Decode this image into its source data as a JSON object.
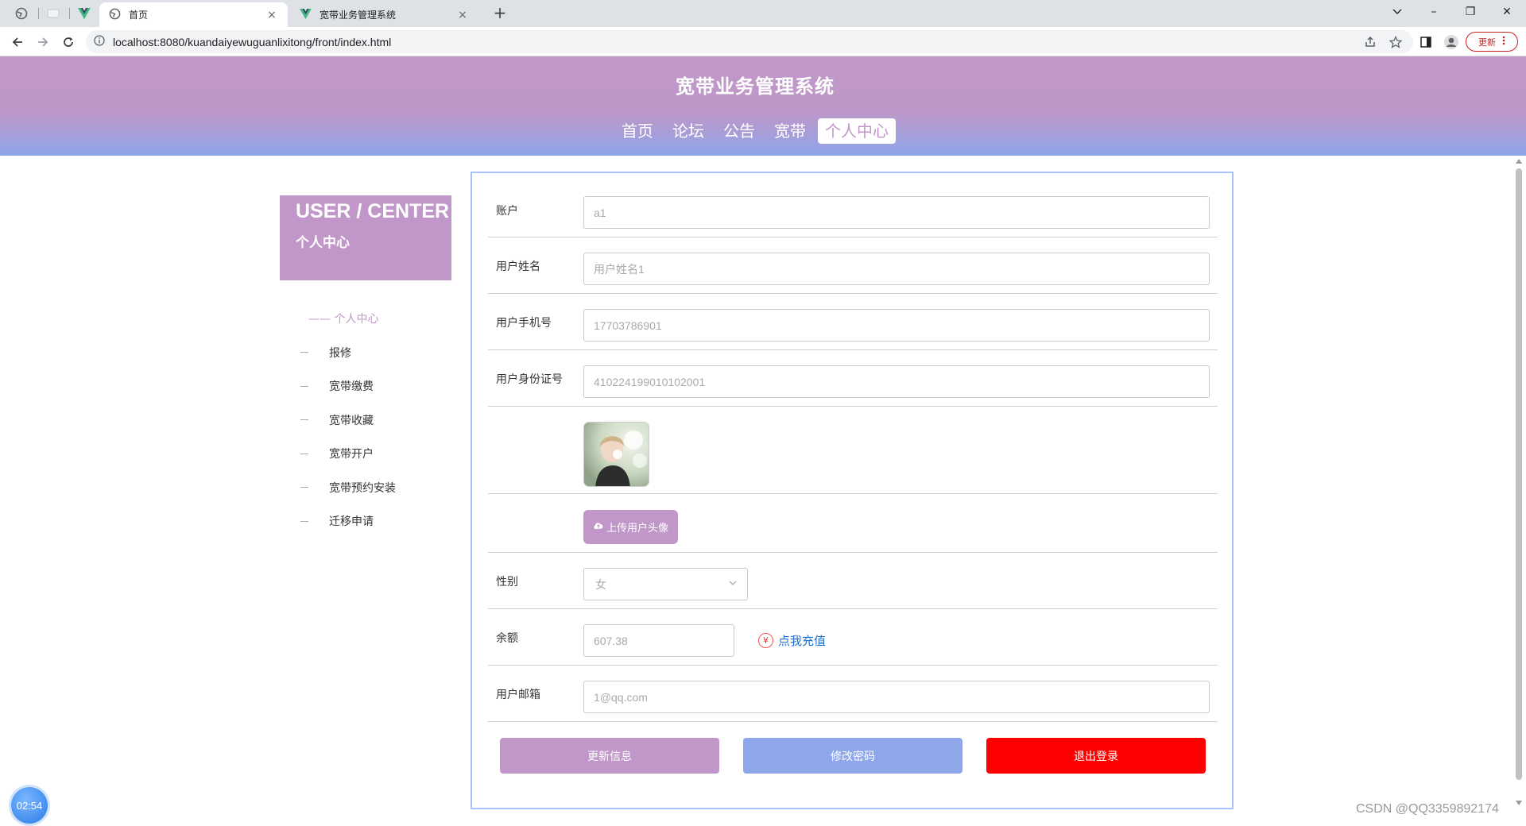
{
  "browser": {
    "tabs": [
      {
        "title": "首页",
        "close": "×"
      },
      {
        "title": "宽带业务管理系统",
        "close": "×"
      }
    ],
    "new_tab": "+",
    "url": "localhost:8080/kuandaiyewuguanlixitong/front/index.html",
    "update_label": "更新",
    "window_controls": {
      "minimize": "–",
      "maximize": "❐",
      "close": "✕"
    }
  },
  "site": {
    "title": "宽带业务管理系统",
    "nav": [
      "首页",
      "论坛",
      "公告",
      "宽带",
      "个人中心"
    ],
    "active_nav": "个人中心"
  },
  "user_center": {
    "title_en": "USER / CENTER",
    "title_zh": "个人中心",
    "current": "—— 个人中心",
    "menu": [
      "报修",
      "宽带缴费",
      "宽带收藏",
      "宽带开户",
      "宽带预约安装",
      "迁移申请"
    ]
  },
  "form": {
    "account": {
      "label": "账户",
      "value": "a1"
    },
    "name": {
      "label": "用户姓名",
      "value": "用户姓名1"
    },
    "phone": {
      "label": "用户手机号",
      "value": "17703786901"
    },
    "id_card": {
      "label": "用户身份证号",
      "value": "410224199010102001"
    },
    "upload_label": "上传用户头像",
    "gender": {
      "label": "性别",
      "value": "女"
    },
    "balance": {
      "label": "余额",
      "value": "607.38",
      "recharge": "点我充值",
      "coin": "¥"
    },
    "email": {
      "label": "用户邮箱",
      "value": "1@qq.com"
    }
  },
  "actions": {
    "update": "更新信息",
    "change_password": "修改密码",
    "logout": "退出登录"
  },
  "colors": {
    "primary": "#c097c8",
    "secondary": "#8ea6ea",
    "danger": "#ff0000",
    "link": "#1f6fd0"
  },
  "timer": "02:54",
  "watermark": "CSDN @QQ3359892174"
}
